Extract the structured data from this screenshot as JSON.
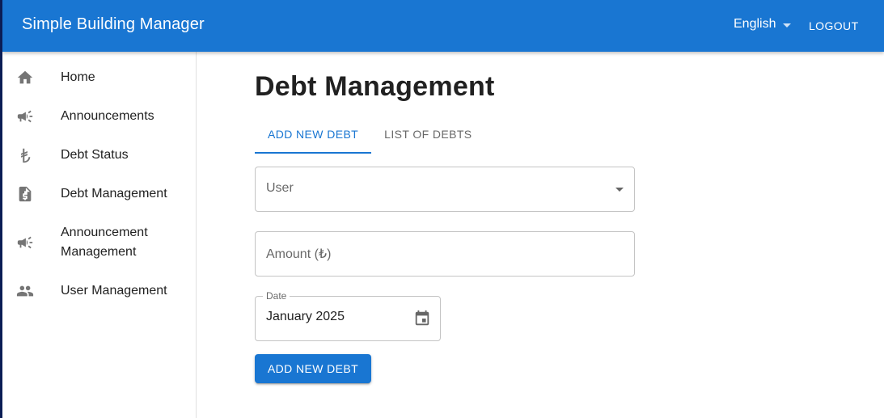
{
  "app": {
    "title": "Simple Building Manager"
  },
  "header": {
    "language": "English",
    "logout_label": "LOGOUT"
  },
  "sidebar": {
    "items": [
      {
        "label": "Home",
        "icon": "home-icon"
      },
      {
        "label": "Announcements",
        "icon": "campaign-icon"
      },
      {
        "label": "Debt Status",
        "icon": "lira-icon"
      },
      {
        "label": "Debt Management",
        "icon": "receipt-icon"
      },
      {
        "label": "Announcement\nManagement",
        "icon": "campaign-icon"
      },
      {
        "label": "User Management",
        "icon": "people-icon"
      }
    ]
  },
  "main": {
    "title": "Debt Management",
    "tabs": [
      {
        "label": "ADD NEW DEBT",
        "active": true
      },
      {
        "label": "LIST OF DEBTS",
        "active": false
      }
    ],
    "form": {
      "user_placeholder": "User",
      "amount_placeholder": "Amount (₺)",
      "date_label": "Date",
      "date_value": "January 2025",
      "submit_label": "ADD NEW DEBT"
    }
  },
  "colors": {
    "primary": "#1976d2"
  }
}
